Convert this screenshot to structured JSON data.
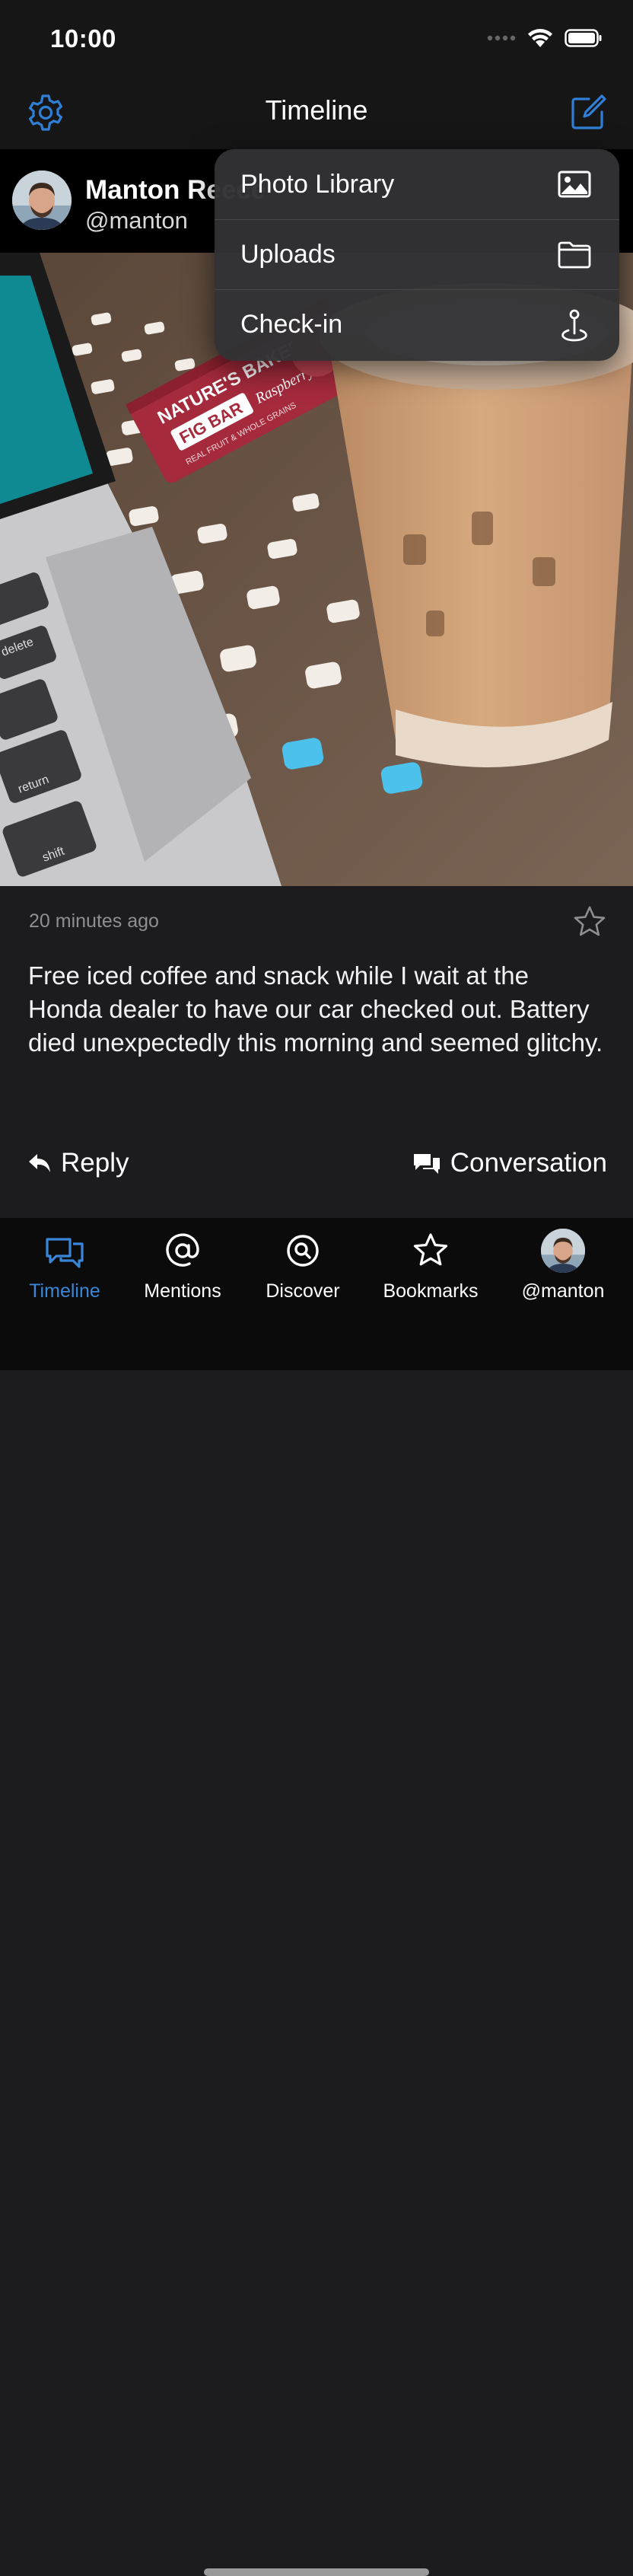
{
  "status_bar": {
    "time": "10:00"
  },
  "nav": {
    "title": "Timeline"
  },
  "post": {
    "author_name": "Manton Reece",
    "author_handle": "@manton",
    "timestamp": "20 minutes ago",
    "text": "Free iced coffee and snack while I wait at the Honda dealer to have our car checked out. Battery died unexpectedly this morning and seemed glitchy.",
    "reply_label": "Reply",
    "conversation_label": "Conversation"
  },
  "photo": {
    "snack_brand": "NATURE'S BAKERY",
    "snack_product": "FIG BAR",
    "snack_flavor": "Raspberry",
    "snack_subtitle": "REAL FRUIT & WHOLE GRAINS",
    "keys": [
      "delete",
      "return",
      "shift"
    ]
  },
  "menu": {
    "items": [
      {
        "label": "Photo Library",
        "icon": "photo-icon"
      },
      {
        "label": "Uploads",
        "icon": "folder-icon"
      },
      {
        "label": "Check-in",
        "icon": "location-pin-icon"
      }
    ]
  },
  "tabs": [
    {
      "label": "Timeline",
      "icon": "chat-bubbles-icon",
      "active": true
    },
    {
      "label": "Mentions",
      "icon": "at-icon",
      "active": false
    },
    {
      "label": "Discover",
      "icon": "discover-icon",
      "active": false
    },
    {
      "label": "Bookmarks",
      "icon": "star-icon",
      "active": false
    },
    {
      "label": "@manton",
      "icon": "avatar",
      "active": false
    }
  ],
  "colors": {
    "accent": "#3a86d8",
    "background": "#1c1c1e",
    "menu": "#323234"
  }
}
